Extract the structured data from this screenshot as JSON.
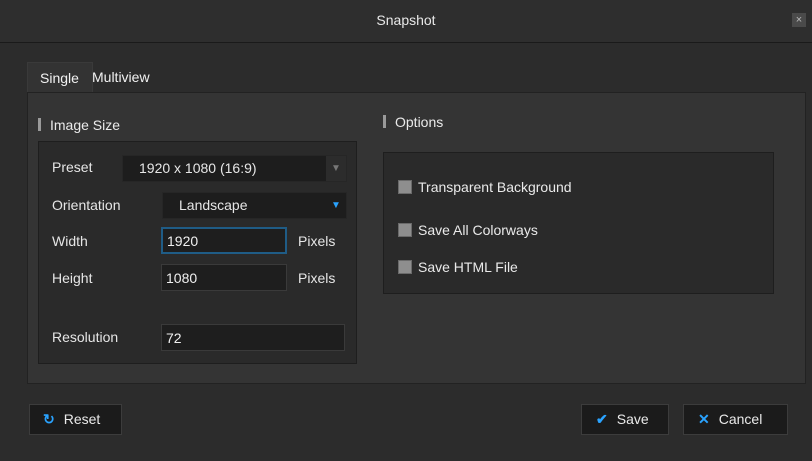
{
  "window": {
    "title": "Snapshot",
    "close_glyph": "×"
  },
  "tabs": [
    {
      "label": "Single",
      "active": true
    },
    {
      "label": "Multiview",
      "active": false
    }
  ],
  "image_size": {
    "title": "Image Size",
    "preset": {
      "label": "Preset",
      "value": "1920 x 1080 (16:9)",
      "arrow": "▼"
    },
    "orientation": {
      "label": "Orientation",
      "value": "Landscape",
      "arrow": "▼"
    },
    "width": {
      "label": "Width",
      "value": "1920",
      "unit": "Pixels"
    },
    "height": {
      "label": "Height",
      "value": "1080",
      "unit": "Pixels"
    },
    "resolution": {
      "label": "Resolution",
      "value": "72"
    }
  },
  "options": {
    "title": "Options",
    "items": [
      {
        "label": "Transparent Background",
        "checked": false
      },
      {
        "label": "Save All Colorways",
        "checked": false
      },
      {
        "label": "Save HTML File",
        "checked": false
      }
    ]
  },
  "buttons": {
    "reset": {
      "label": "Reset",
      "icon": "refresh-icon",
      "glyph": "↻"
    },
    "save": {
      "label": "Save",
      "icon": "checkmark-icon",
      "glyph": "✔"
    },
    "cancel": {
      "label": "Cancel",
      "icon": "close-icon",
      "glyph": "✕"
    }
  },
  "colors": {
    "accent": "#2aa3ff",
    "focus_border": "#1f5c86"
  }
}
